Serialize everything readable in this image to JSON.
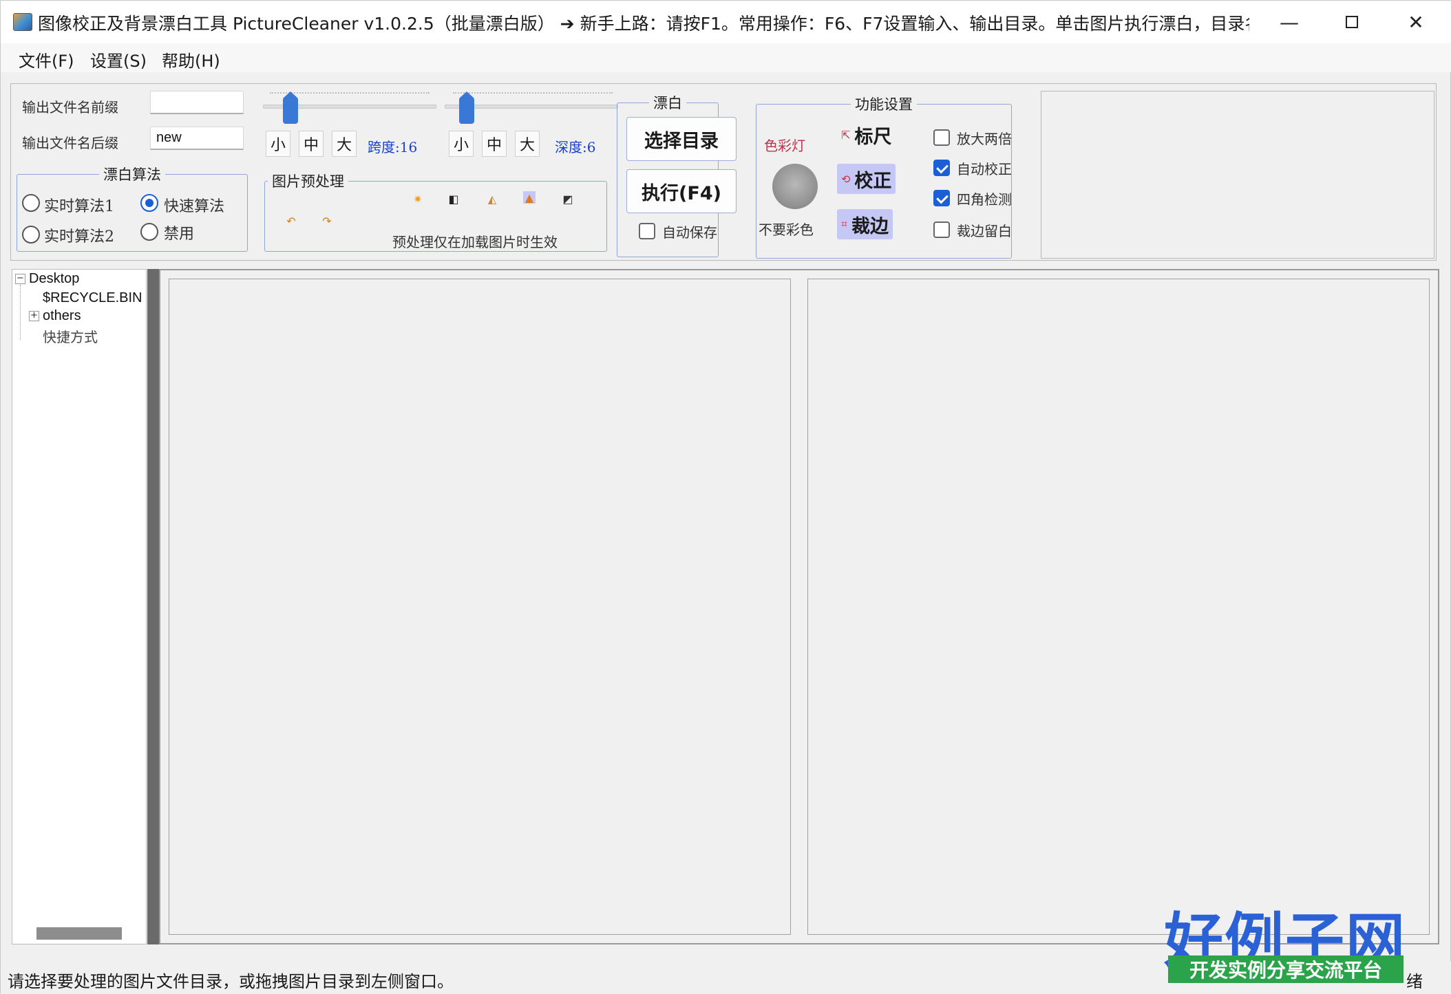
{
  "window": {
    "title": "图像校正及背景漂白工具 PictureCleaner v1.0.2.5（批量漂白版） ➔ 新手上路：请按F1。常用操作：F6、F7设置输入、输出目录。单击图片执行漂白，目录名回车...",
    "minimize_glyph": "—",
    "close_glyph": "✕"
  },
  "menu": {
    "file": "文件(F)",
    "settings": "设置(S)",
    "help": "帮助(H)"
  },
  "output": {
    "prefix_label": "输出文件名前缀",
    "prefix_value": "",
    "suffix_label": "输出文件名后缀",
    "suffix_value": "new"
  },
  "slider1": {
    "small": "小",
    "medium": "中",
    "large": "大",
    "value_label": "跨度:16"
  },
  "slider2": {
    "small": "小",
    "medium": "中",
    "large": "大",
    "value_label": "深度:6"
  },
  "algorithm": {
    "legend": "漂白算法",
    "options": [
      "实时算法1",
      "快速算法",
      "实时算法2",
      "禁用"
    ],
    "selected": "快速算法"
  },
  "preprocess": {
    "legend": "图片预处理",
    "note": "预处理仅在加载图片时生效",
    "icons": [
      "brightness-icon",
      "contrast-icon",
      "levels-icon",
      "sharpen-icon",
      "invert-icon",
      "undo-icon",
      "redo-icon"
    ]
  },
  "bleach": {
    "legend": "漂白",
    "select_dir": "选择目录",
    "execute": "执行(F4)",
    "auto_save": "自动保存",
    "auto_save_checked": false
  },
  "features": {
    "legend": "功能设置",
    "color_lamp": "色彩灯",
    "no_color": "不要彩色",
    "ruler": "标尺",
    "correct": "校正",
    "crop": "裁边",
    "checks": [
      {
        "label": "放大两倍",
        "checked": false
      },
      {
        "label": "自动校正",
        "checked": true
      },
      {
        "label": "四角检测",
        "checked": true
      },
      {
        "label": "裁边留白",
        "checked": false
      }
    ]
  },
  "tree": {
    "root": "Desktop",
    "items": [
      "$RECYCLE.BIN",
      "others",
      "快捷方式"
    ]
  },
  "status": {
    "message": "请选择要处理的图片文件目录，或拖拽图片目录到左侧窗口。",
    "right": "绪"
  },
  "watermark": {
    "logo": "好例子网",
    "tagline": "开发实例分享交流平台"
  },
  "colors": {
    "accent": "#1a5fd6",
    "slider_thumb": "#3a78d8",
    "selected_tool": "#c5c8f4",
    "value_label": "#1a3fd0"
  }
}
